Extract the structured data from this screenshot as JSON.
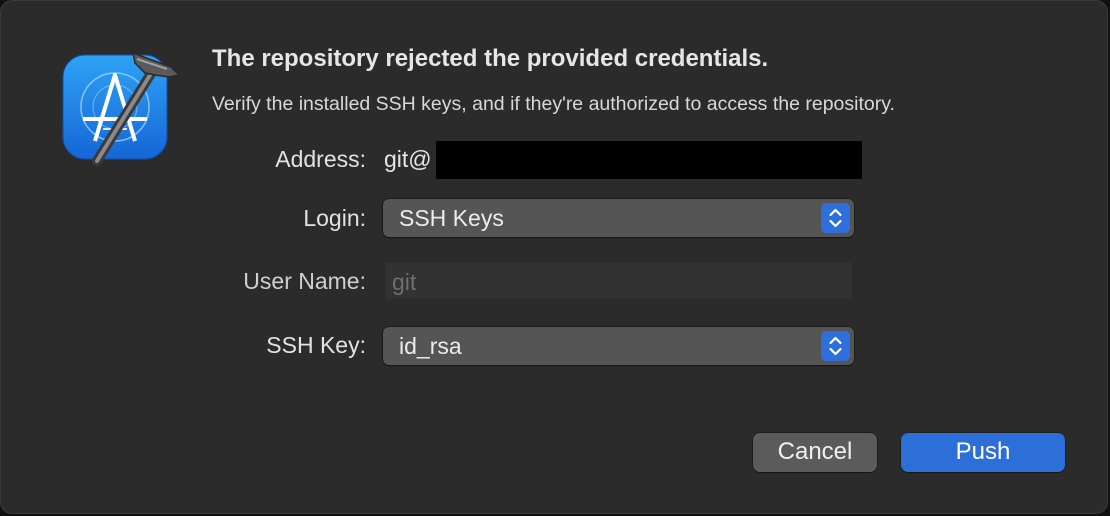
{
  "dialog": {
    "app_icon": "xcode-hammer-icon",
    "title": "The repository rejected the provided credentials.",
    "message": "Verify the installed SSH keys, and if they're authorized to access the repository."
  },
  "form": {
    "address": {
      "label": "Address:",
      "value": "git@"
    },
    "login": {
      "label": "Login:",
      "value": "SSH Keys",
      "icon": "chevron-up-down-icon"
    },
    "username": {
      "label": "User Name:",
      "value": "git"
    },
    "ssh_key": {
      "label": "SSH Key:",
      "value": "id_rsa",
      "icon": "chevron-up-down-icon"
    }
  },
  "buttons": {
    "cancel": "Cancel",
    "push": "Push"
  },
  "colors": {
    "accent": "#2d6fd8",
    "sheet_background": "#2b2b2b"
  }
}
